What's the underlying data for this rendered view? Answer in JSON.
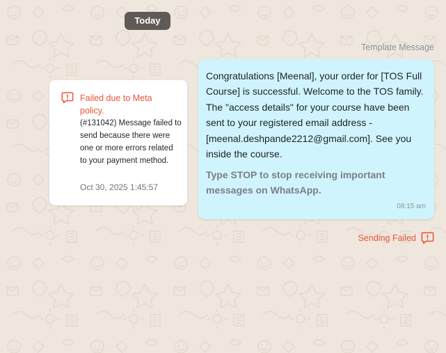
{
  "date_separator": "Today",
  "colors": {
    "wallpaper": "#efe7de",
    "outgoing_bubble": "#d0f4fd",
    "error": "#e8553c",
    "date_pill": "#5f5a55"
  },
  "error_card": {
    "icon": "alert-icon",
    "title": "Failed due to Meta policy.",
    "body": "(#131042) Message failed to send because there were one or more errors related to your payment method.",
    "timestamp": "Oct 30, 2025 1:45:57"
  },
  "message": {
    "type_label": "Template Message",
    "body": "Congratulations [Meenal], your order for [TOS Full Course] is successful. Welcome to the TOS family. The \"access details\" for your course have been sent to your registered email address - [meenal.deshpande2212@gmail.com]. See you inside the course.",
    "footer": "Type STOP to stop receiving important messages on WhatsApp.",
    "time": "08:15 am",
    "status_label": "Sending Failed",
    "status_icon": "alert-icon"
  }
}
